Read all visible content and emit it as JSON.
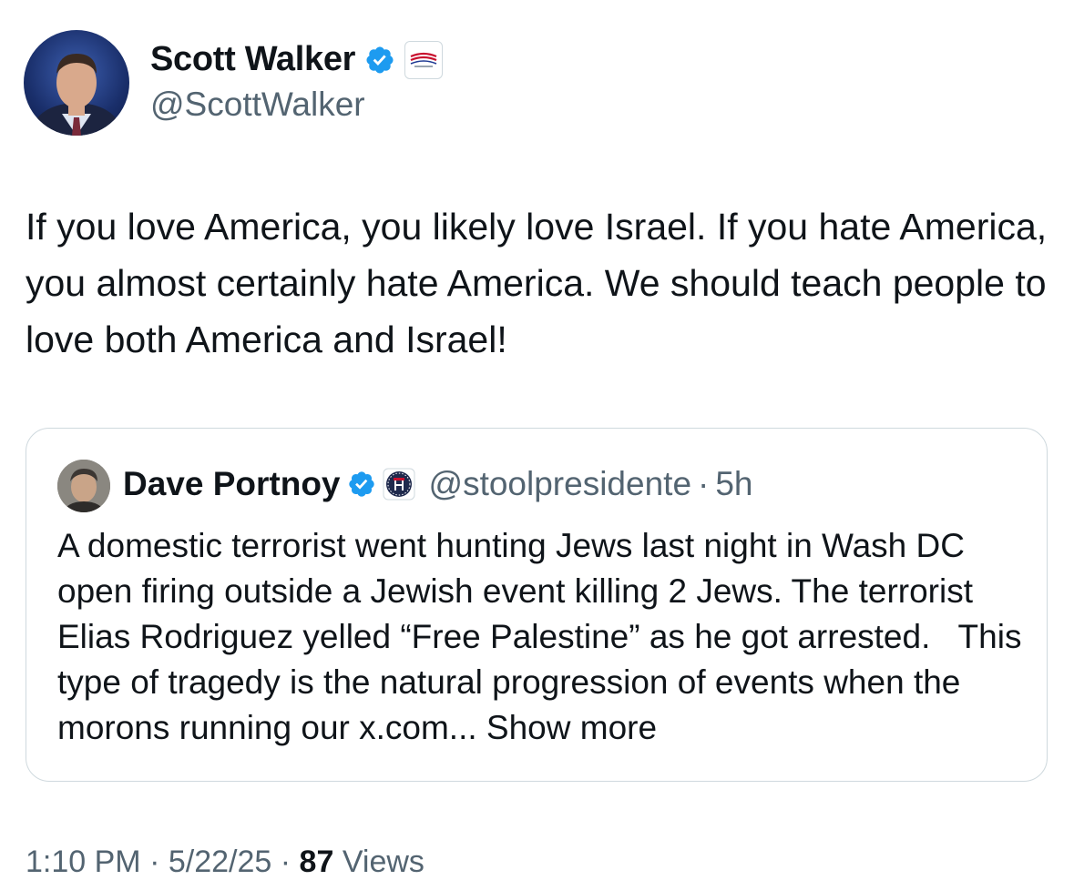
{
  "author": {
    "name": "Scott Walker",
    "handle": "@ScottWalker",
    "verified": true,
    "affiliation_badge": "flag-badge-icon"
  },
  "tweet": {
    "text": "If you love America, you likely love Israel. If you hate America, you almost certainly hate America. We should teach people to love both America and Israel!"
  },
  "quoted_tweet": {
    "name": "Dave Portnoy",
    "verified": true,
    "affiliation_badge": "barstool-badge-icon",
    "handle": "@stoolpresidente",
    "separator": "·",
    "time": "5h",
    "text": "A domestic terrorist went hunting Jews last night in Wash DC open firing outside a Jewish event killing 2 Jews. The terrorist Elias Rodriguez yelled “Free Palestine” as he got arrested.   This type of tragedy is the natural progression of events when the morons running our x.com...",
    "show_more_label": "Show more"
  },
  "meta": {
    "time": "1:10 PM",
    "separator": "·",
    "date": "5/22/25",
    "views_count": "87",
    "views_label": "Views"
  },
  "colors": {
    "verified": "#1d9bf0",
    "secondary_text": "#536471",
    "border": "#cfd9de"
  }
}
